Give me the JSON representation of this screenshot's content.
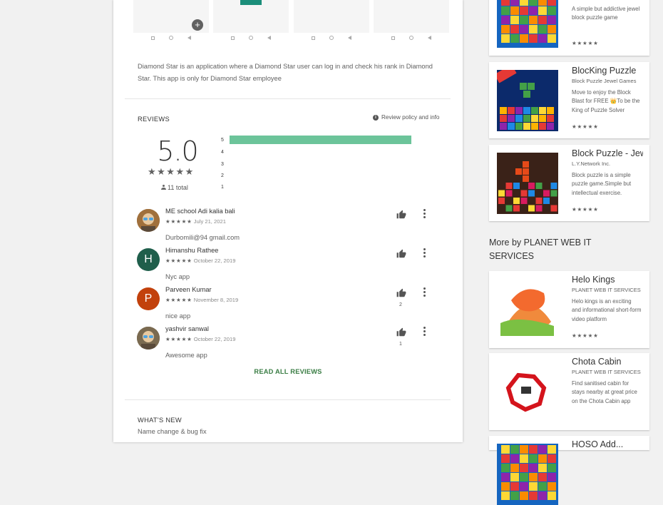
{
  "description": "Diamond Star is an application where a Diamond Star user can log in and check his rank in Diamond Star. This app is only for Diamond Star employee",
  "reviews": {
    "title": "REVIEWS",
    "policy_label": "Review policy and info",
    "score": "5.0",
    "total": "11 total",
    "histogram": [
      {
        "label": "5",
        "fraction": 1.0
      },
      {
        "label": "4",
        "fraction": 0
      },
      {
        "label": "3",
        "fraction": 0
      },
      {
        "label": "2",
        "fraction": 0
      },
      {
        "label": "1",
        "fraction": 0
      }
    ],
    "items": [
      {
        "name": "ME school Adi kalia bali",
        "stars": "★★★★★",
        "date": "July 21, 2021",
        "text": "Durbomili@94 gmail.com",
        "helpful": "",
        "avatar_letter": "",
        "avatar_color": "#a0703c"
      },
      {
        "name": "Himanshu Rathee",
        "stars": "★★★★★",
        "date": "October 22, 2019",
        "text": "Nyc app",
        "helpful": "",
        "avatar_letter": "H",
        "avatar_color": "#1f5e4b"
      },
      {
        "name": "Parveen Kumar",
        "stars": "★★★★★",
        "date": "November 8, 2019",
        "text": "nice app",
        "helpful": "2",
        "avatar_letter": "P",
        "avatar_color": "#c2410c"
      },
      {
        "name": "yashvir sanwal",
        "stars": "★★★★★",
        "date": "October 22, 2019",
        "text": "Awesome app",
        "helpful": "1",
        "avatar_letter": "",
        "avatar_color": "#7a6a50"
      }
    ],
    "read_all": "READ ALL REVIEWS"
  },
  "whats_new": {
    "title": "WHAT'S NEW",
    "body": "Name change & bug fix"
  },
  "similar_apps": [
    {
      "title": "",
      "developer": "",
      "desc": "A simple but addictive jewel block puzzle game",
      "stars": "★★★★★",
      "icon": "jewel-block-puzzle-icon"
    },
    {
      "title": "BlocKing Puzzle",
      "developer": "Block Puzzle Jewel Games",
      "desc": "Move to enjoy the Block Blast for FREE 👑To be the King of Puzzle Solver",
      "stars": "★★★★★",
      "icon": "blocking-puzzle-2020-icon"
    },
    {
      "title": "Block Puzzle - Jewel",
      "developer": "L.Y.Network Inc.",
      "desc": "Block puzzle is a simple puzzle game.Simple but intellectual exercise.",
      "stars": "★★★★★",
      "icon": "block-puzzle-jewel-icon"
    }
  ],
  "more_by": {
    "heading": "More by PLANET WEB IT SERVICES",
    "apps": [
      {
        "title": "Helo Kings",
        "developer": "PLANET WEB IT SERVICES",
        "desc": "Helo kings is an exciting and informational short-form video platform",
        "stars": "★★★★★",
        "icon": "helo-kings-icon"
      },
      {
        "title": "Chota Cabin",
        "developer": "PLANET WEB IT SERVICES",
        "desc": "Find sanitised cabin for stays nearby at great price on the Chota Cabin app",
        "stars": "",
        "icon": "chota-cabin-icon"
      },
      {
        "title": "HOSO Add...",
        "developer": "",
        "desc": "",
        "stars": "",
        "icon": "hoso-icon"
      }
    ]
  },
  "colors": {
    "accent_green": "#3a7d44",
    "bar_green": "#6cc49a"
  }
}
